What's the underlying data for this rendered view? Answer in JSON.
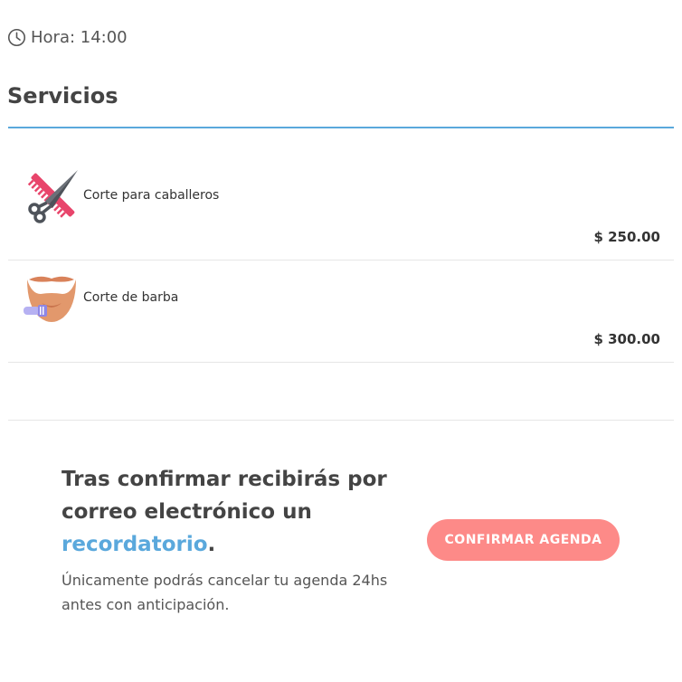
{
  "hora": {
    "label": "Hora: 14:00"
  },
  "servicios": {
    "title": "Servicios",
    "items": [
      {
        "name": "Corte para caballeros",
        "price": "$ 250.00",
        "icon": "comb-scissors-icon"
      },
      {
        "name": "Corte de barba",
        "price": "$ 300.00",
        "icon": "beard-trimmer-icon"
      }
    ]
  },
  "confirm": {
    "text_before": "Tras confirmar recibirás por correo electrónico un ",
    "highlight": "recordatorio",
    "text_after": ".",
    "note": "Únicamente podrás cancelar tu agenda 24hs antes con anticipación.",
    "button_label": "CONFIRMAR AGENDA"
  },
  "colors": {
    "accent": "#5aa8dc",
    "button": "#fd8a88",
    "divider": "#e6e6e6"
  }
}
